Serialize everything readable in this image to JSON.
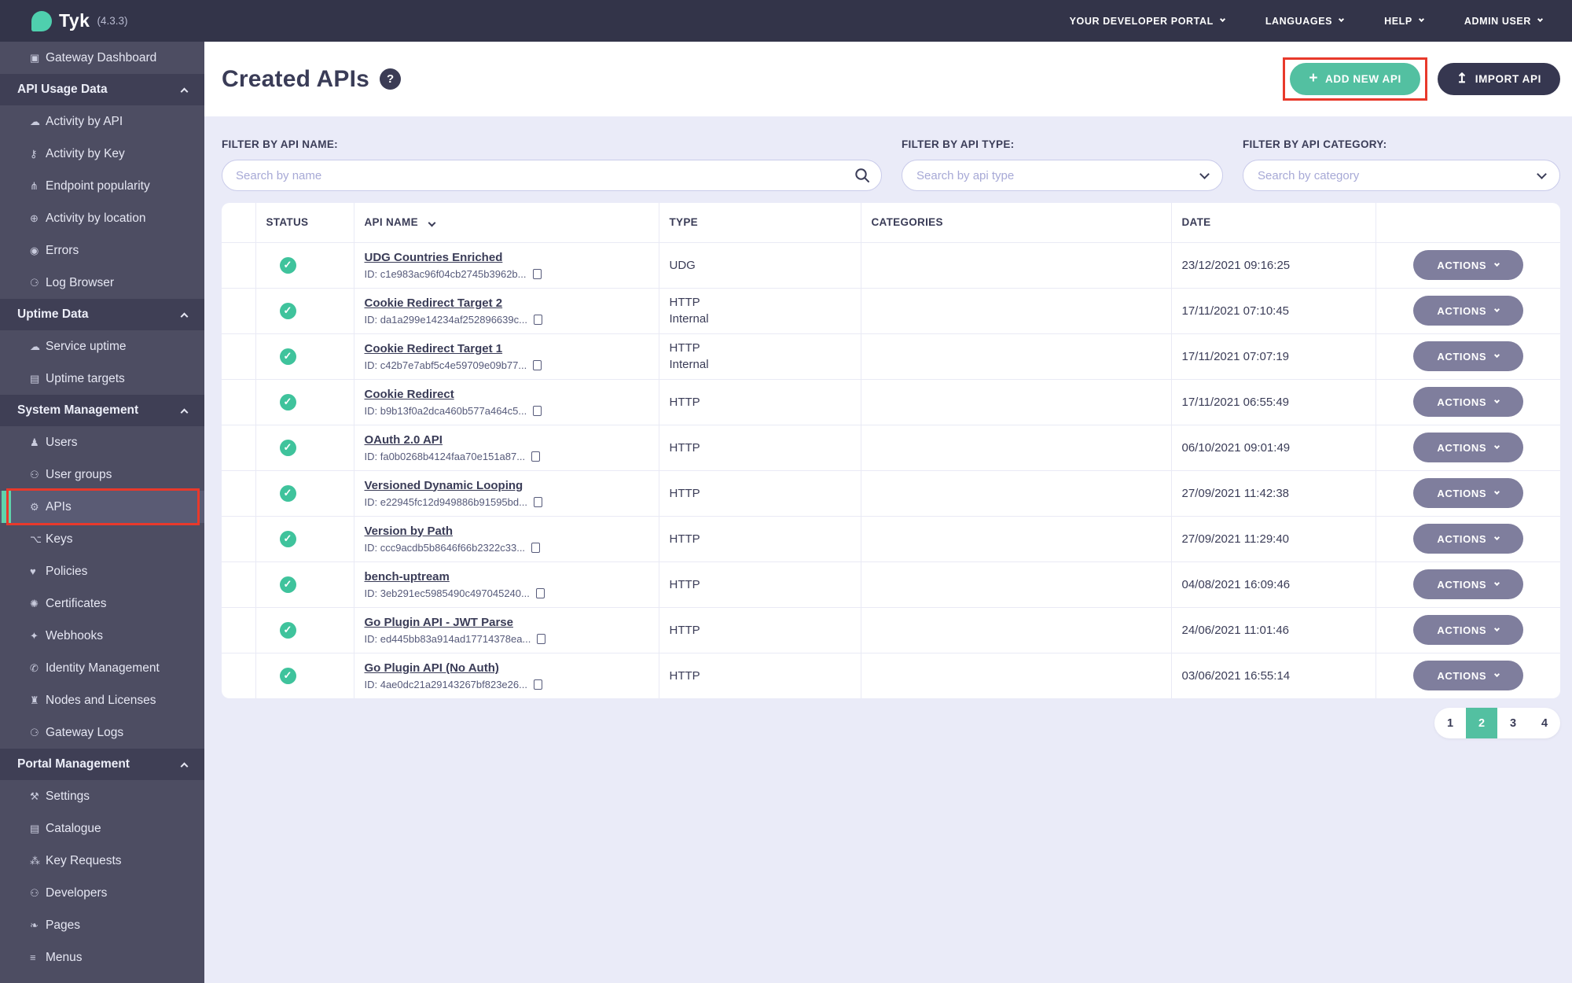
{
  "colors": {
    "accent_teal": "#53c0a1",
    "status_green": "#3fc39c",
    "annotation_red": "#e8392b",
    "topbar_bg": "#333449",
    "sidebar_bg": "#4d4d62",
    "actions_gray": "#7f7e9d"
  },
  "topbar": {
    "brand": {
      "name": "Tyk",
      "version": "(4.3.3)"
    },
    "menus": [
      {
        "label": "YOUR DEVELOPER PORTAL"
      },
      {
        "label": "LANGUAGES"
      },
      {
        "label": "HELP"
      },
      {
        "label": "ADMIN USER"
      }
    ]
  },
  "sidebar": {
    "entries": [
      {
        "kind": "item",
        "icon": "monitor-icon",
        "glyph": "▣",
        "label": "Gateway Dashboard"
      },
      {
        "kind": "section",
        "label": "API Usage Data"
      },
      {
        "kind": "item",
        "icon": "cloud-icon",
        "glyph": "☁",
        "label": "Activity by API"
      },
      {
        "kind": "item",
        "icon": "key-icon",
        "glyph": "⚷",
        "label": "Activity by Key"
      },
      {
        "kind": "item",
        "icon": "branch-icon",
        "glyph": "⋔",
        "label": "Endpoint popularity"
      },
      {
        "kind": "item",
        "icon": "globe-icon",
        "glyph": "⊕",
        "label": "Activity by location"
      },
      {
        "kind": "item",
        "icon": "bomb-icon",
        "glyph": "◉",
        "label": "Errors"
      },
      {
        "kind": "item",
        "icon": "bug-icon",
        "glyph": "⚆",
        "label": "Log Browser"
      },
      {
        "kind": "section",
        "label": "Uptime Data"
      },
      {
        "kind": "item",
        "icon": "cloud-icon",
        "glyph": "☁",
        "label": "Service uptime"
      },
      {
        "kind": "item",
        "icon": "list-icon",
        "glyph": "▤",
        "label": "Uptime targets"
      },
      {
        "kind": "section",
        "label": "System Management"
      },
      {
        "kind": "item",
        "icon": "user-icon",
        "glyph": "♟",
        "label": "Users"
      },
      {
        "kind": "item",
        "icon": "users-icon",
        "glyph": "⚇",
        "label": "User groups"
      },
      {
        "kind": "item",
        "icon": "gears-icon",
        "glyph": "⚙",
        "label": "APIs",
        "selected": true,
        "annotated": true
      },
      {
        "kind": "item",
        "icon": "network-icon",
        "glyph": "⌥",
        "label": "Keys"
      },
      {
        "kind": "item",
        "icon": "policy-icon",
        "glyph": "♥",
        "label": "Policies"
      },
      {
        "kind": "item",
        "icon": "rosette-icon",
        "glyph": "✺",
        "label": "Certificates"
      },
      {
        "kind": "item",
        "icon": "bell-icon",
        "glyph": "✦",
        "label": "Webhooks"
      },
      {
        "kind": "item",
        "icon": "phone-icon",
        "glyph": "✆",
        "label": "Identity Management"
      },
      {
        "kind": "item",
        "icon": "bank-icon",
        "glyph": "♜",
        "label": "Nodes and Licenses"
      },
      {
        "kind": "item",
        "icon": "bug-icon",
        "glyph": "⚆",
        "label": "Gateway Logs"
      },
      {
        "kind": "section",
        "label": "Portal Management"
      },
      {
        "kind": "item",
        "icon": "wrench-icon",
        "glyph": "⚒",
        "label": "Settings"
      },
      {
        "kind": "item",
        "icon": "catalogue-icon",
        "glyph": "▤",
        "label": "Catalogue"
      },
      {
        "kind": "item",
        "icon": "paw-icon",
        "glyph": "⁂",
        "label": "Key Requests"
      },
      {
        "kind": "item",
        "icon": "people-icon",
        "glyph": "⚇",
        "label": "Developers"
      },
      {
        "kind": "item",
        "icon": "leaf-icon",
        "glyph": "❧",
        "label": "Pages"
      },
      {
        "kind": "item",
        "icon": "hamburger-icon",
        "glyph": "≡",
        "label": "Menus"
      }
    ]
  },
  "header": {
    "title": "Created APIs",
    "help_glyph": "?",
    "add_plus_glyph": "+",
    "add_new_api_label": "ADD NEW API",
    "import_glyph": "↥",
    "import_api_label": "IMPORT API"
  },
  "filters": {
    "name": {
      "label": "FILTER BY API NAME:",
      "placeholder": "Search by name"
    },
    "type": {
      "label": "FILTER BY API TYPE:",
      "placeholder": "Search by api type"
    },
    "category": {
      "label": "FILTER BY API CATEGORY:",
      "placeholder": "Search by category"
    }
  },
  "table": {
    "columns": [
      "STATUS",
      "API NAME",
      "TYPE",
      "CATEGORIES",
      "DATE"
    ],
    "id_prefix": "ID: ",
    "status_ok_glyph": "✓",
    "actions_label": "ACTIONS",
    "rows": [
      {
        "name": "UDG Countries Enriched",
        "id": "c1e983ac96f04cb2745b3962b...",
        "type_lines": [
          "UDG"
        ],
        "date": "23/12/2021 09:16:25"
      },
      {
        "name": "Cookie Redirect Target 2",
        "id": "da1a299e14234af252896639c...",
        "type_lines": [
          "HTTP",
          "Internal"
        ],
        "date": "17/11/2021 07:10:45"
      },
      {
        "name": "Cookie Redirect Target 1",
        "id": "c42b7e7abf5c4e59709e09b77...",
        "type_lines": [
          "HTTP",
          "Internal"
        ],
        "date": "17/11/2021 07:07:19"
      },
      {
        "name": "Cookie Redirect",
        "id": "b9b13f0a2dca460b577a464c5...",
        "type_lines": [
          "HTTP"
        ],
        "date": "17/11/2021 06:55:49"
      },
      {
        "name": "OAuth 2.0 API",
        "id": "fa0b0268b4124faa70e151a87...",
        "type_lines": [
          "HTTP"
        ],
        "date": "06/10/2021 09:01:49"
      },
      {
        "name": "Versioned Dynamic Looping",
        "id": "e22945fc12d949886b91595bd...",
        "type_lines": [
          "HTTP"
        ],
        "date": "27/09/2021 11:42:38"
      },
      {
        "name": "Version by Path",
        "id": "ccc9acdb5b8646f66b2322c33...",
        "type_lines": [
          "HTTP"
        ],
        "date": "27/09/2021 11:29:40"
      },
      {
        "name": "bench-uptream",
        "id": "3eb291ec5985490c497045240...",
        "type_lines": [
          "HTTP"
        ],
        "date": "04/08/2021 16:09:46"
      },
      {
        "name": "Go Plugin API - JWT Parse",
        "id": "ed445bb83a914ad17714378ea...",
        "type_lines": [
          "HTTP"
        ],
        "date": "24/06/2021 11:01:46"
      },
      {
        "name": "Go Plugin API (No Auth)",
        "id": "4ae0dc21a29143267bf823e26...",
        "type_lines": [
          "HTTP"
        ],
        "date": "03/06/2021 16:55:14"
      }
    ]
  },
  "pagination": {
    "pages": [
      "1",
      "2",
      "3",
      "4"
    ],
    "active": "2"
  }
}
